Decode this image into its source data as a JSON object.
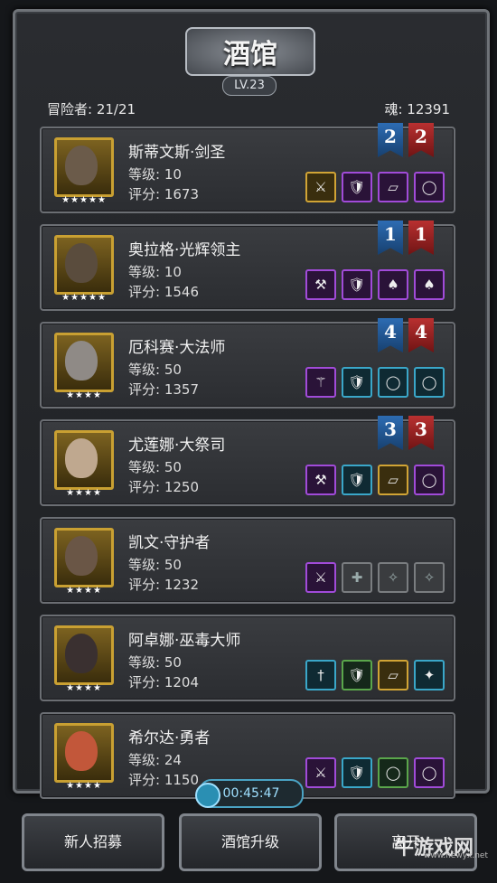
{
  "header": {
    "title": "酒馆",
    "level": "LV.23"
  },
  "stats": {
    "adventurers": "冒险者: 21/21",
    "souls": "魂: 12391"
  },
  "heroes": [
    {
      "name": "斯蒂文斯·剑圣",
      "level": "等级: 10",
      "score": "评分: 1673",
      "stars": "★★★★★",
      "ribbon_blue": "2",
      "ribbon_red": "2",
      "gear": [
        "sword-icon",
        "armor-icon",
        "scroll-icon",
        "ring-icon"
      ]
    },
    {
      "name": "奥拉格·光辉领主",
      "level": "等级: 10",
      "score": "评分: 1546",
      "stars": "★★★★★",
      "ribbon_blue": "1",
      "ribbon_red": "1",
      "gear": [
        "hammer-icon",
        "armor-icon",
        "cloak-icon",
        "cloak-icon"
      ]
    },
    {
      "name": "厄科赛·大法师",
      "level": "等级: 50",
      "score": "评分: 1357",
      "stars": "★★★★",
      "ribbon_blue": "4",
      "ribbon_red": "4",
      "gear": [
        "staff-icon",
        "armor-icon",
        "ring-icon",
        "ring-icon"
      ]
    },
    {
      "name": "尤莲娜·大祭司",
      "level": "等级: 50",
      "score": "评分: 1250",
      "stars": "★★★★",
      "ribbon_blue": "3",
      "ribbon_red": "3",
      "gear": [
        "hammer-icon",
        "armor-icon",
        "scroll-icon",
        "ring-icon"
      ]
    },
    {
      "name": "凯文·守护者",
      "level": "等级: 50",
      "score": "评分: 1232",
      "stars": "★★★★",
      "ribbon_blue": "",
      "ribbon_red": "",
      "gear": [
        "sword-icon",
        "armor-slot-icon",
        "accessory-slot-icon",
        "accessory-slot-icon"
      ]
    },
    {
      "name": "阿卓娜·巫毒大师",
      "level": "等级: 50",
      "score": "评分: 1204",
      "stars": "★★★★",
      "ribbon_blue": "",
      "ribbon_red": "",
      "gear": [
        "dagger-icon",
        "armor-icon",
        "scroll-icon",
        "shuriken-icon"
      ]
    },
    {
      "name": "希尔达·勇者",
      "level": "等级: 24",
      "score": "评分: 1150",
      "stars": "★★★★",
      "ribbon_blue": "",
      "ribbon_red": "",
      "gear": [
        "axe-icon",
        "armor-icon",
        "ring-icon",
        "ring-icon"
      ]
    }
  ],
  "timer": "00:45:47",
  "buttons": {
    "recruit": "新人招募",
    "upgrade": "酒馆升级",
    "leave": "离开"
  },
  "watermark": {
    "logo": "牛游戏网",
    "url": "www.newyx.net"
  }
}
